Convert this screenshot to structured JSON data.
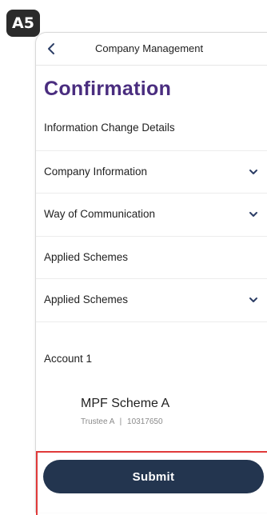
{
  "step_badge": "A5",
  "nav": {
    "title": "Company Management",
    "back_icon": "chevron-left-icon"
  },
  "page": {
    "heading": "Confirmation",
    "section_label": "Information Change Details"
  },
  "rows": [
    {
      "label": "Company Information",
      "expandable": true
    },
    {
      "label": "Way of Communication",
      "expandable": true
    },
    {
      "label": "Applied Schemes",
      "expandable": false
    },
    {
      "label": "Applied Schemes",
      "expandable": true
    }
  ],
  "account": {
    "label": "Account 1",
    "scheme_name": "MPF Scheme A",
    "trustee": "Trustee A",
    "separator": "|",
    "scheme_number": "10317650"
  },
  "footer": {
    "submit_label": "Submit"
  },
  "colors": {
    "heading": "#4a2d7f",
    "submit_bg": "#23354f",
    "highlight_border": "#e03a3a",
    "chevron": "#2c3e66"
  }
}
